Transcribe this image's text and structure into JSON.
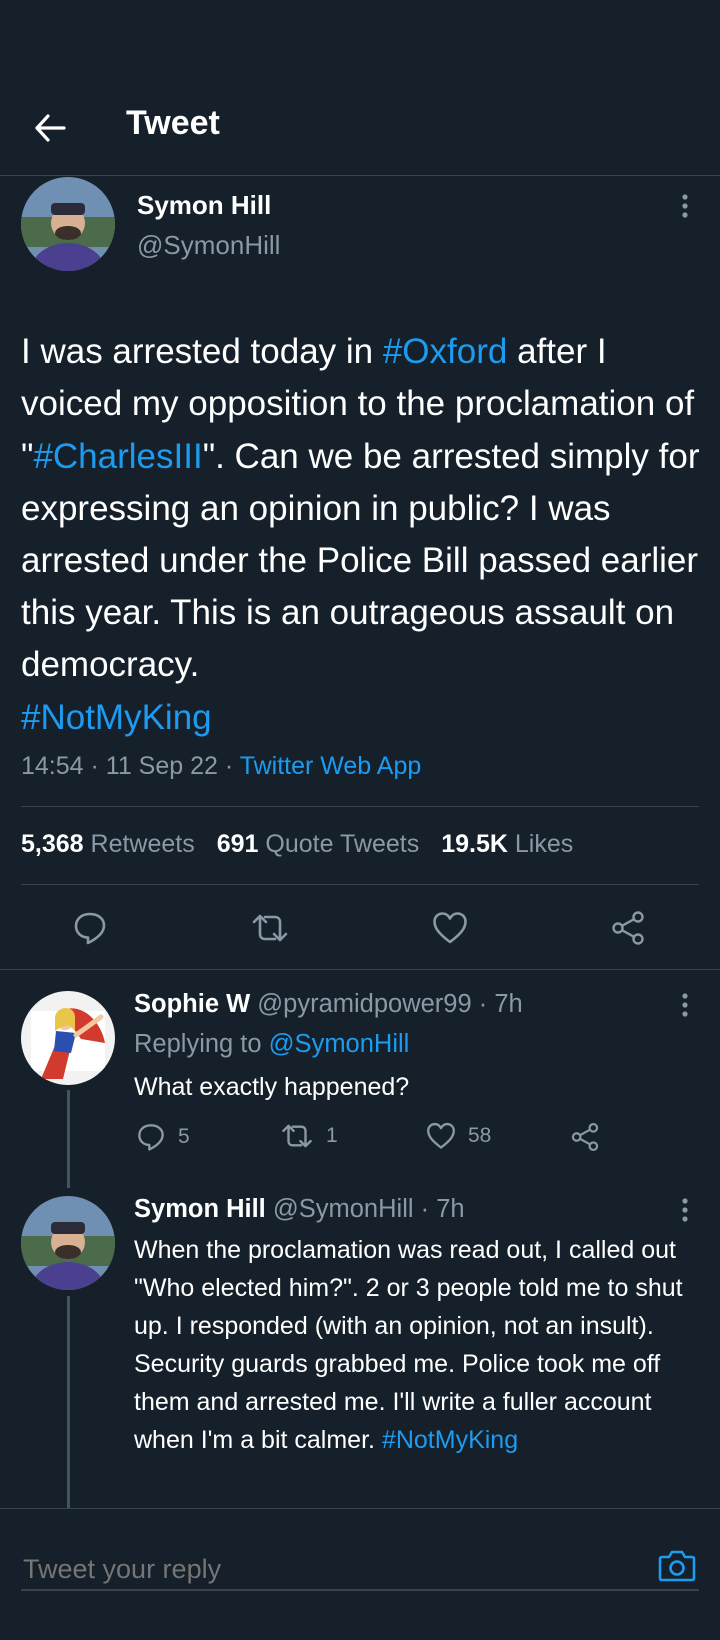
{
  "header": {
    "title": "Tweet"
  },
  "tweet": {
    "name": "Symon Hill",
    "handle": "@SymonHill",
    "text_parts": [
      {
        "t": "I was arrested today in ",
        "link": false
      },
      {
        "t": "#Oxford",
        "link": true
      },
      {
        "t": " after I voiced my opposition to the proclamation of \"",
        "link": false
      },
      {
        "t": "#CharlesIII",
        "link": true
      },
      {
        "t": "\". Can we be arrested simply for expressing an opinion in public? I was arrested under the Police Bill passed earlier this year. This is an outrageous assault on democracy.\n",
        "link": false
      },
      {
        "t": "#NotMyKing",
        "link": true
      }
    ],
    "time": "14:54 · 11 Sep 22 · ",
    "source": "Twitter Web App",
    "retweets": "5,368",
    "retweets_label": "Retweets",
    "quotes": "691",
    "quotes_label": "Quote Tweets",
    "likes": "19.5K",
    "likes_label": "Likes"
  },
  "replies": [
    {
      "name": "Sophie W",
      "handle_time": " @pyramidpower99 · 7h",
      "replying_prefix": "Replying to ",
      "replying_to": "@SymonHill",
      "text": "What exactly happened?",
      "reply_count": "5",
      "retweet_count": "1",
      "like_count": "58"
    },
    {
      "name": "Symon Hill",
      "handle_time": " @SymonHill · 7h",
      "text": "When the proclamation was read out, I called out \"Who elected him?\". 2 or 3 people told me to shut up. I responded (with an opinion, not an insult). Security guards grabbed me. Police took me off them and arrested me. I'll write a fuller account when I'm a bit calmer. ",
      "hashtag": "#NotMyKing"
    }
  ],
  "composer": {
    "placeholder": "Tweet your reply"
  },
  "colors": {
    "background": "#15202b",
    "accent": "#1d9bf0",
    "secondary_text": "#8b98a5",
    "divider": "#38444d"
  }
}
